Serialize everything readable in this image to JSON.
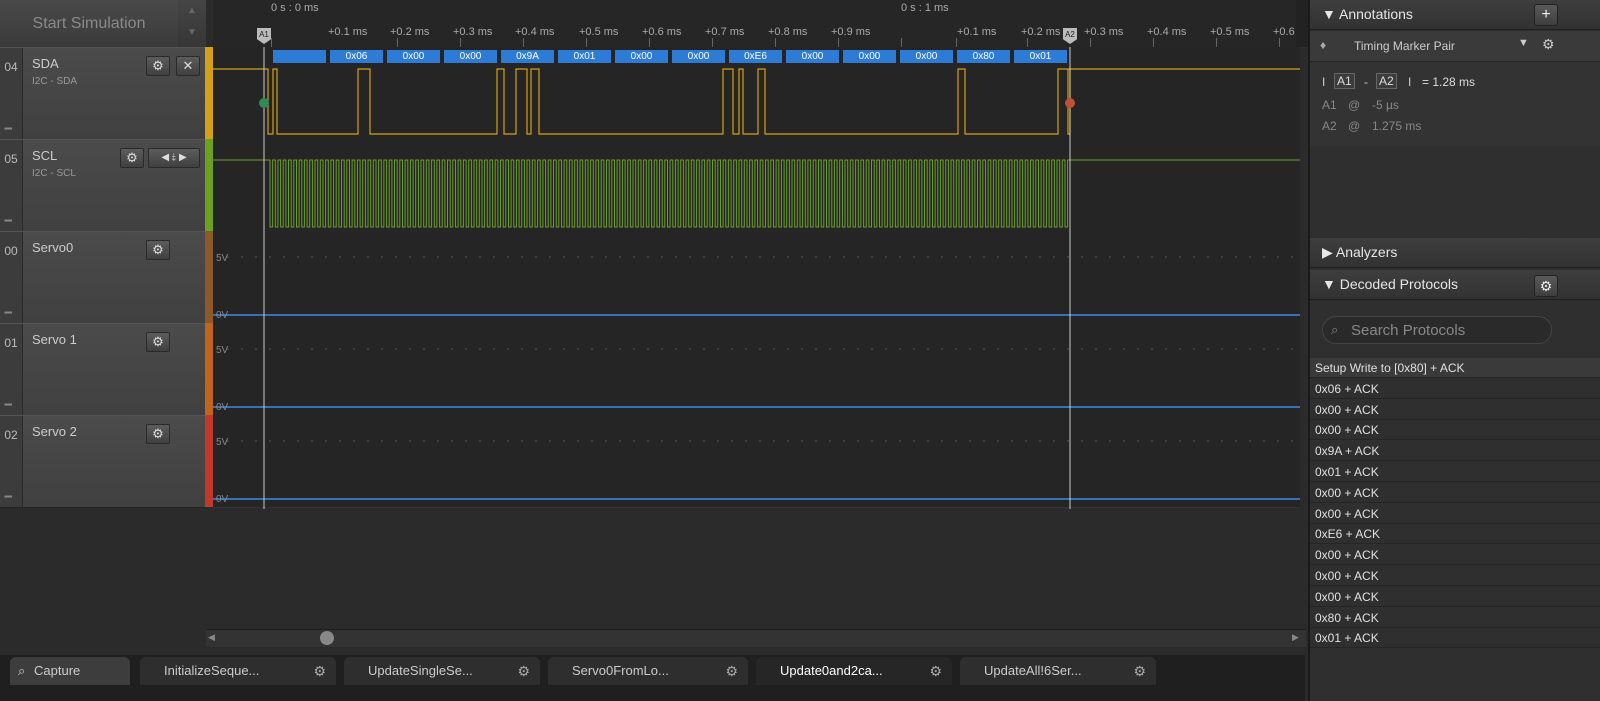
{
  "toolbar": {
    "start_label": "Start Simulation"
  },
  "ruler": {
    "top_labels": [
      "0 s : 0 ms",
      "0 s : 1 ms"
    ],
    "ticks": [
      "+0.1 ms",
      "+0.2 ms",
      "+0.3 ms",
      "+0.4 ms",
      "+0.5 ms",
      "+0.6 ms",
      "+0.7 ms",
      "+0.8 ms",
      "+0.9 ms",
      "+0.1 ms",
      "+0.2 ms",
      "+0.3 ms",
      "+0.4 ms",
      "+0.5 ms",
      "+0.6"
    ],
    "marker_a1": "A1",
    "marker_a2": "A2"
  },
  "channels": [
    {
      "num": "04",
      "name": "SDA",
      "sub": "I2C - SDA",
      "color": "#d4a017"
    },
    {
      "num": "05",
      "name": "SCL",
      "sub": "I2C - SCL",
      "color": "#6aa121"
    },
    {
      "num": "00",
      "name": "Servo0",
      "sub": "",
      "color": "#8b5a2b"
    },
    {
      "num": "01",
      "name": "Servo 1",
      "sub": "",
      "color": "#c0651e"
    },
    {
      "num": "02",
      "name": "Servo 2",
      "sub": "",
      "color": "#c0392b"
    }
  ],
  "levels": {
    "high": "5V",
    "low": "0V"
  },
  "bytes": [
    "0x06",
    "0x00",
    "0x00",
    "0x9A",
    "0x01",
    "0x00",
    "0x00",
    "0xE6",
    "0x00",
    "0x00",
    "0x00",
    "0x80",
    "0x01"
  ],
  "tabs": [
    {
      "label": "Capture"
    },
    {
      "label": "InitializeSeque..."
    },
    {
      "label": "UpdateSingleSe..."
    },
    {
      "label": "Servo0FromLo..."
    },
    {
      "label": "Update0and2ca..."
    },
    {
      "label": "UpdateAll!6Ser..."
    }
  ],
  "annotations": {
    "title": "Annotations",
    "marker_pair": "Timing Marker Pair",
    "a1": "A1",
    "a2": "A2",
    "delta": "= 1.28 ms",
    "a1_at": "-5 µs",
    "a2_at": "1.275 ms",
    "at": "@"
  },
  "analyzers": {
    "title": "Analyzers"
  },
  "decoded": {
    "title": "Decoded Protocols",
    "search_placeholder": "Search Protocols",
    "rows": [
      "Setup Write to [0x80] + ACK",
      "0x06 + ACK",
      "0x00 + ACK",
      "0x00 + ACK",
      "0x9A + ACK",
      "0x01 + ACK",
      "0x00 + ACK",
      "0x00 + ACK",
      "0xE6 + ACK",
      "0x00 + ACK",
      "0x00 + ACK",
      "0x00 + ACK",
      "0x80 + ACK",
      "0x01 + ACK"
    ]
  },
  "colors": {
    "accent": "#2d7bd4",
    "sda": "#d4a017",
    "scl": "#6aa121",
    "servo": "#3a8ee6"
  }
}
